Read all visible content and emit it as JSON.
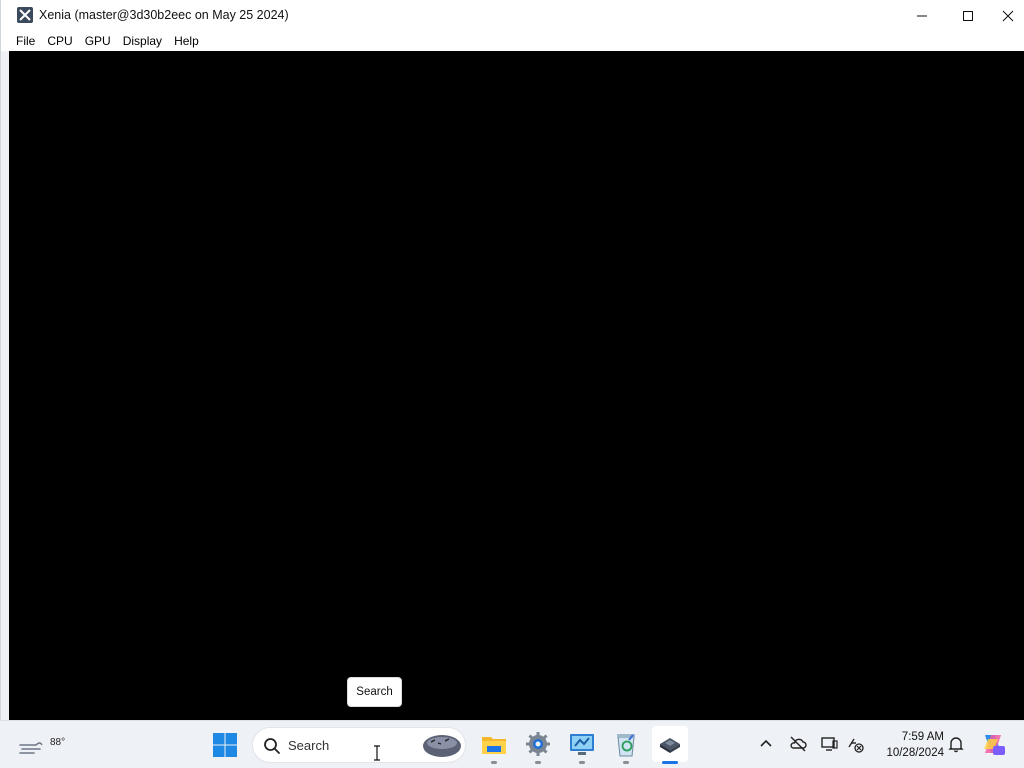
{
  "window": {
    "title": "Xenia (master@3d30b2eec on May 25 2024)",
    "menu": [
      "File",
      "CPU",
      "GPU",
      "Display",
      "Help"
    ]
  },
  "tooltip": {
    "text": "Search"
  },
  "taskbar": {
    "weather_temp": "88°",
    "search_placeholder": "Search",
    "clock_time": "7:59 AM",
    "clock_date": "10/28/2024",
    "apps": [
      "file-explorer-icon",
      "settings-gear-icon",
      "control-panel-icon",
      "recycle-bin-icon",
      "xenia-app-icon"
    ]
  },
  "colors": {
    "viewport": "#000000",
    "taskbar": "#eef1f5",
    "accent": "#1a73e8"
  }
}
